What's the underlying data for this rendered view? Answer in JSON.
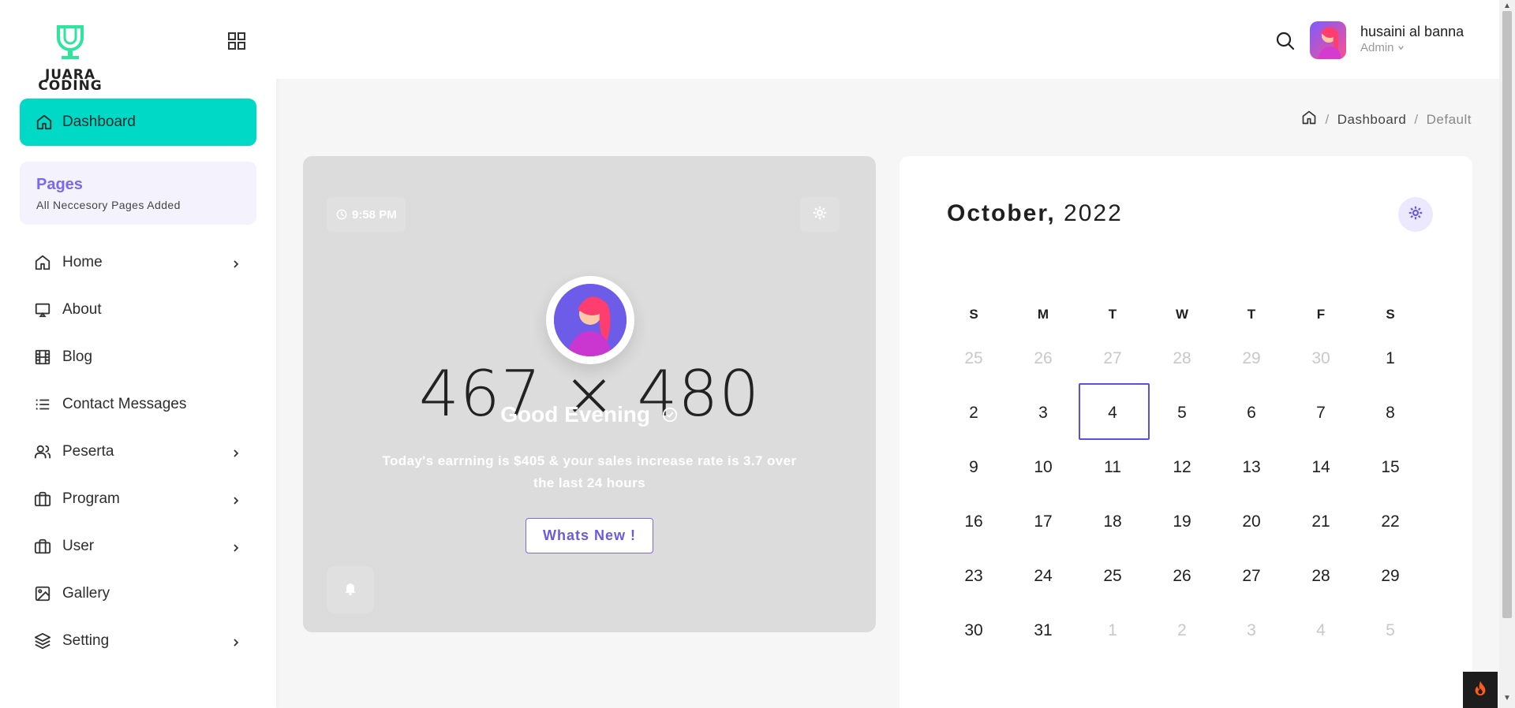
{
  "brand": {
    "line1": "JUARA",
    "line2": "CODING",
    "accent": "#00d9c6"
  },
  "sidebar": {
    "active_item": {
      "label": "Dashboard",
      "icon": "home-icon"
    },
    "pages_box": {
      "title": "Pages",
      "subtitle": "All Neccesory Pages Added"
    },
    "items": [
      {
        "label": "Home",
        "icon": "home-icon",
        "has_submenu": true
      },
      {
        "label": "About",
        "icon": "monitor-icon",
        "has_submenu": false
      },
      {
        "label": "Blog",
        "icon": "film-icon",
        "has_submenu": false
      },
      {
        "label": "Contact Messages",
        "icon": "list-icon",
        "has_submenu": false
      },
      {
        "label": "Peserta",
        "icon": "users-icon",
        "has_submenu": true
      },
      {
        "label": "Program",
        "icon": "briefcase-icon",
        "has_submenu": true
      },
      {
        "label": "User",
        "icon": "briefcase-icon",
        "has_submenu": true
      },
      {
        "label": "Gallery",
        "icon": "image-icon",
        "has_submenu": false
      },
      {
        "label": "Setting",
        "icon": "layers-icon",
        "has_submenu": true
      }
    ]
  },
  "header": {
    "user_name": "husaini al banna",
    "user_role": "Admin"
  },
  "breadcrumb": {
    "items": [
      "Dashboard",
      "Default"
    ]
  },
  "welcome": {
    "time": "9:58 PM",
    "placeholder_text": "467 × 480",
    "greeting": "Good Evening",
    "description": "Today's earrning is $405 & your sales increase rate is 3.7 over the last 24 hours",
    "button_label": "Whats New !"
  },
  "calendar": {
    "month": "October,",
    "year": "2022",
    "weekdays": [
      "S",
      "M",
      "T",
      "W",
      "T",
      "F",
      "S"
    ],
    "weeks": [
      [
        {
          "d": "25",
          "muted": true
        },
        {
          "d": "26",
          "muted": true
        },
        {
          "d": "27",
          "muted": true
        },
        {
          "d": "28",
          "muted": true
        },
        {
          "d": "29",
          "muted": true
        },
        {
          "d": "30",
          "muted": true
        },
        {
          "d": "1"
        }
      ],
      [
        {
          "d": "2"
        },
        {
          "d": "3"
        },
        {
          "d": "4",
          "today": true
        },
        {
          "d": "5"
        },
        {
          "d": "6"
        },
        {
          "d": "7"
        },
        {
          "d": "8"
        }
      ],
      [
        {
          "d": "9"
        },
        {
          "d": "10"
        },
        {
          "d": "11"
        },
        {
          "d": "12"
        },
        {
          "d": "13"
        },
        {
          "d": "14"
        },
        {
          "d": "15"
        }
      ],
      [
        {
          "d": "16"
        },
        {
          "d": "17"
        },
        {
          "d": "18"
        },
        {
          "d": "19"
        },
        {
          "d": "20"
        },
        {
          "d": "21"
        },
        {
          "d": "22"
        }
      ],
      [
        {
          "d": "23"
        },
        {
          "d": "24"
        },
        {
          "d": "25"
        },
        {
          "d": "26"
        },
        {
          "d": "27"
        },
        {
          "d": "28"
        },
        {
          "d": "29"
        }
      ],
      [
        {
          "d": "30"
        },
        {
          "d": "31"
        },
        {
          "d": "1",
          "muted": true
        },
        {
          "d": "2",
          "muted": true
        },
        {
          "d": "3",
          "muted": true
        },
        {
          "d": "4",
          "muted": true
        },
        {
          "d": "5",
          "muted": true
        }
      ]
    ],
    "accent": "#5b4ee0"
  }
}
